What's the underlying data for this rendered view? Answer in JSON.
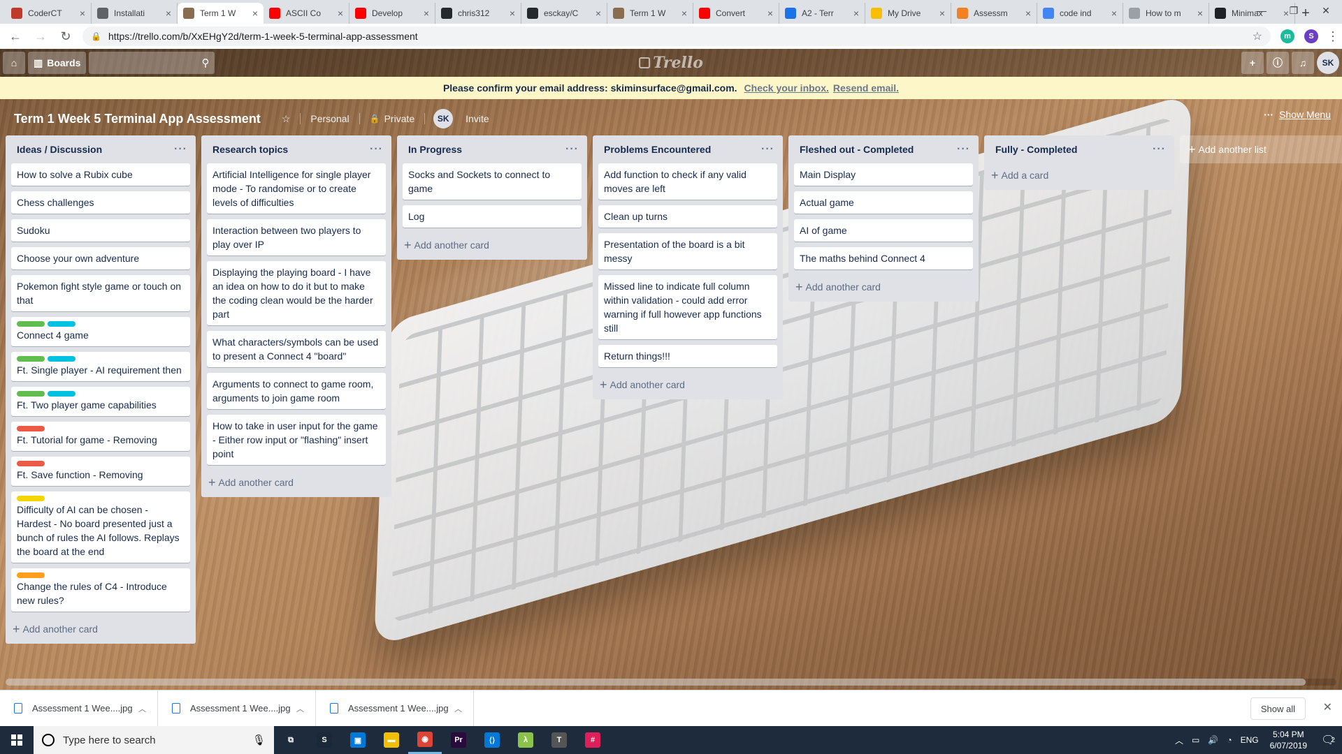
{
  "browser": {
    "tabs": [
      {
        "title": "CoderCT",
        "icon": "codercat-icon",
        "color": "#c0392b"
      },
      {
        "title": "Installati",
        "icon": "page-icon",
        "color": "#5f6368"
      },
      {
        "title": "Term 1 W",
        "icon": "trello-icon",
        "color": "#8a6d4e",
        "active": true
      },
      {
        "title": "ASCII Co",
        "icon": "youtube-icon",
        "color": "#ff0000"
      },
      {
        "title": "Develop",
        "icon": "youtube-icon",
        "color": "#ff0000"
      },
      {
        "title": "chris312",
        "icon": "github-icon",
        "color": "#24292e"
      },
      {
        "title": "esckay/C",
        "icon": "github-icon",
        "color": "#24292e"
      },
      {
        "title": "Term 1 W",
        "icon": "trello-icon",
        "color": "#8a6d4e"
      },
      {
        "title": "Convert",
        "icon": "youtube-icon",
        "color": "#ff0000"
      },
      {
        "title": "A2 - Terr",
        "icon": "a2-icon",
        "color": "#1a73e8"
      },
      {
        "title": "My Drive",
        "icon": "drive-icon",
        "color": "#fbbc04"
      },
      {
        "title": "Assessm",
        "icon": "assessment-icon",
        "color": "#f48024"
      },
      {
        "title": "code ind",
        "icon": "google-icon",
        "color": "#4285f4"
      },
      {
        "title": "How to m",
        "icon": "globe-icon",
        "color": "#9aa0a6"
      },
      {
        "title": "Minimax",
        "icon": "wikipedia-icon",
        "color": "#202124"
      }
    ],
    "url": "https://trello.com/b/XxEHgY2d/term-1-week-5-terminal-app-assessment",
    "ext_m": "m",
    "profile": "S"
  },
  "trello": {
    "boards_label": "Boards",
    "logo_text": "Trello",
    "user_initials": "SK",
    "banner": {
      "text": "Please confirm your email address: skiminsurface@gmail.com.",
      "link1": "Check your inbox.",
      "link2": "Resend email."
    },
    "board": {
      "title": "Term 1 Week 5 Terminal App Assessment",
      "visibility_team": "Personal",
      "visibility": "Private",
      "member_initials": "SK",
      "invite": "Invite",
      "show_menu": "Show Menu"
    },
    "lists": [
      {
        "title": "Ideas / Discussion",
        "add_label": "Add another card",
        "cards": [
          {
            "text": "How to solve a Rubix cube",
            "labels": []
          },
          {
            "text": "Chess challenges",
            "labels": []
          },
          {
            "text": "Sudoku",
            "labels": []
          },
          {
            "text": "Choose your own adventure",
            "labels": []
          },
          {
            "text": "Pokemon fight style game or touch on that",
            "labels": []
          },
          {
            "text": "Connect 4 game",
            "labels": [
              "#61bd4f",
              "#00c2e0"
            ]
          },
          {
            "text": "Ft. Single player - AI requirement then",
            "labels": [
              "#61bd4f",
              "#00c2e0"
            ]
          },
          {
            "text": "Ft. Two player game capabilities",
            "labels": [
              "#61bd4f",
              "#00c2e0"
            ]
          },
          {
            "text": "Ft. Tutorial for game - Removing",
            "labels": [
              "#eb5a46"
            ]
          },
          {
            "text": "Ft. Save function - Removing",
            "labels": [
              "#eb5a46"
            ]
          },
          {
            "text": "Difficulty of AI can be chosen - Hardest - No board presented just a bunch of rules the AI follows. Replays the board at the end",
            "labels": [
              "#f2d600"
            ]
          },
          {
            "text": "Change the rules of C4 - Introduce new rules?",
            "labels": [
              "#ff9f1a"
            ]
          }
        ]
      },
      {
        "title": "Research topics",
        "add_label": "Add another card",
        "cards": [
          {
            "text": "Artificial Intelligence for single player mode - To randomise or to create levels of difficulties",
            "labels": []
          },
          {
            "text": "Interaction between two players to play over IP",
            "labels": []
          },
          {
            "text": "Displaying the playing board - I have an idea on how to do it but to make the coding clean would be the harder part",
            "labels": []
          },
          {
            "text": "What characters/symbols can be used to present a Connect 4 \"board\"",
            "labels": []
          },
          {
            "text": "Arguments to connect to game room, arguments to join game room",
            "labels": []
          },
          {
            "text": "How to take in user input for the game - Either row input or \"flashing\" insert point",
            "labels": []
          }
        ]
      },
      {
        "title": "In Progress",
        "add_label": "Add another card",
        "cards": [
          {
            "text": "Socks and Sockets to connect to game",
            "labels": []
          },
          {
            "text": "Log",
            "labels": []
          }
        ]
      },
      {
        "title": "Problems Encountered",
        "add_label": "Add another card",
        "cards": [
          {
            "text": "Add function to check if any valid moves are left",
            "labels": []
          },
          {
            "text": "Clean up turns",
            "labels": []
          },
          {
            "text": "Presentation of the board is a bit messy",
            "labels": []
          },
          {
            "text": "Missed line to indicate full column within validation - could add error warning if full however app functions still",
            "labels": []
          },
          {
            "text": "Return things!!!",
            "labels": []
          }
        ]
      },
      {
        "title": "Fleshed out - Completed",
        "add_label": "Add another card",
        "cards": [
          {
            "text": "Main Display",
            "labels": []
          },
          {
            "text": "Actual game",
            "labels": []
          },
          {
            "text": "AI of game",
            "labels": []
          },
          {
            "text": "The maths behind Connect 4",
            "labels": []
          }
        ]
      },
      {
        "title": "Fully - Completed",
        "add_label": "Add a card",
        "cards": []
      }
    ],
    "add_list_label": "Add another list"
  },
  "downloads": {
    "items": [
      "Assessment 1 Wee....jpg",
      "Assessment 1 Wee....jpg",
      "Assessment 1 Wee....jpg"
    ],
    "show_all": "Show all"
  },
  "taskbar": {
    "search_placeholder": "Type here to search",
    "apps": [
      {
        "icon": "task-view-icon",
        "glyph": "⧉",
        "color": ""
      },
      {
        "icon": "steam-icon",
        "glyph": "S",
        "color": "#1b2838"
      },
      {
        "icon": "store-icon",
        "glyph": "▣",
        "color": "#0078d7"
      },
      {
        "icon": "file-explorer-icon",
        "glyph": "▬",
        "color": "#f0c000"
      },
      {
        "icon": "chrome-icon",
        "glyph": "◉",
        "color": "#db4437",
        "active": true
      },
      {
        "icon": "premiere-icon",
        "glyph": "Pr",
        "color": "#2a0a3a"
      },
      {
        "icon": "vscode-icon",
        "glyph": "⟨⟩",
        "color": "#0078d7"
      },
      {
        "icon": "lambda-icon",
        "glyph": "λ",
        "color": "#8bc34a"
      },
      {
        "icon": "typora-icon",
        "glyph": "T",
        "color": "#555555"
      },
      {
        "icon": "slack-icon",
        "glyph": "#",
        "color": "#e01e5a"
      }
    ],
    "language": "ENG",
    "time": "5:04 PM",
    "date": "6/07/2019",
    "notifications": "2"
  }
}
